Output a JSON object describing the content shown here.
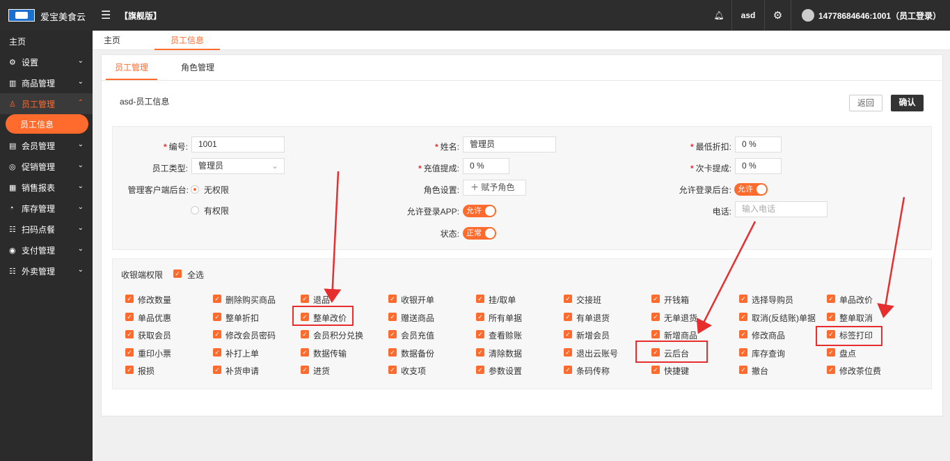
{
  "app": {
    "name": "爱宝美食云",
    "edition": "【旗舰版】",
    "user": "asd",
    "account": "14778684646:1001（员工登录）"
  },
  "sidebar": {
    "items": [
      {
        "label": "主页",
        "icon": "home-icon",
        "glyph": "",
        "chevron": ""
      },
      {
        "label": "设置",
        "icon": "gear-icon",
        "glyph": "⚙",
        "chevron": "⌄"
      },
      {
        "label": "商品管理",
        "icon": "goods-icon",
        "glyph": "▥",
        "chevron": "⌄"
      },
      {
        "label": "员工管理",
        "icon": "staff-icon",
        "glyph": "♙",
        "chevron": "⌃"
      },
      {
        "label": "会员管理",
        "icon": "member-icon",
        "glyph": "▤",
        "chevron": "⌄"
      },
      {
        "label": "促销管理",
        "icon": "promo-icon",
        "glyph": "◎",
        "chevron": "⌄"
      },
      {
        "label": "销售报表",
        "icon": "report-icon",
        "glyph": "▦",
        "chevron": "⌄"
      },
      {
        "label": "库存管理",
        "icon": "stock-icon",
        "glyph": "◔",
        "chevron": "⌄"
      },
      {
        "label": "扫码点餐",
        "icon": "scan-icon",
        "glyph": "☷",
        "chevron": "⌄"
      },
      {
        "label": "支付管理",
        "icon": "pay-icon",
        "glyph": "◉",
        "chevron": "⌄"
      },
      {
        "label": "外卖管理",
        "icon": "delivery-icon",
        "glyph": "☷",
        "chevron": "⌄"
      }
    ],
    "sub_active": "员工信息"
  },
  "tabs": [
    "主页",
    "员工信息"
  ],
  "subtabs": [
    "员工管理",
    "角色管理"
  ],
  "page_title": "asd-员工信息",
  "buttons": {
    "back": "返回",
    "confirm": "确认"
  },
  "form": {
    "code_label": "编号:",
    "code": "1001",
    "name_label": "姓名:",
    "name": "管理员",
    "min_discount_label": "最低折扣:",
    "min_discount": "0 %",
    "type_label": "员工类型:",
    "type": "管理员",
    "recharge_label": "充值提成:",
    "recharge": "0 %",
    "card_label": "次卡提成:",
    "card": "0 %",
    "client_admin_label": "管理客户端后台:",
    "radio_no": "无权限",
    "radio_yes": "有权限",
    "role_label": "角色设置:",
    "role_btn": "＋ 赋予角色",
    "allow_backend_label": "允许登录后台:",
    "allow_backend": "允许",
    "allow_app_label": "允许登录APP:",
    "allow_app": "允许",
    "phone_label": "电话:",
    "phone_placeholder": "输入电话",
    "status_label": "状态:",
    "status": "正常"
  },
  "perms": {
    "title": "收银端权限",
    "select_all": "全选",
    "rows": [
      [
        "修改数量",
        "删除购买商品",
        "退品",
        "收银开单",
        "挂/取单",
        "交接班",
        "开钱箱",
        "选择导购员",
        "单品改价"
      ],
      [
        "单品优惠",
        "整单折扣",
        "整单改价",
        "赠送商品",
        "所有单据",
        "有单退货",
        "无单退货",
        "取消(反结账)单据",
        "整单取消"
      ],
      [
        "获取会员",
        "修改会员密码",
        "会员积分兑换",
        "会员充值",
        "查看赊账",
        "新增会员",
        "新增商品",
        "修改商品",
        "标签打印"
      ],
      [
        "重印小票",
        "补打上单",
        "数据传输",
        "数据备份",
        "清除数据",
        "退出云账号",
        "云后台",
        "库存查询",
        "盘点"
      ],
      [
        "报损",
        "补货申请",
        "进货",
        "收支项",
        "参数设置",
        "条码传称",
        "快捷键",
        "撤台",
        "修改茶位费"
      ]
    ]
  }
}
